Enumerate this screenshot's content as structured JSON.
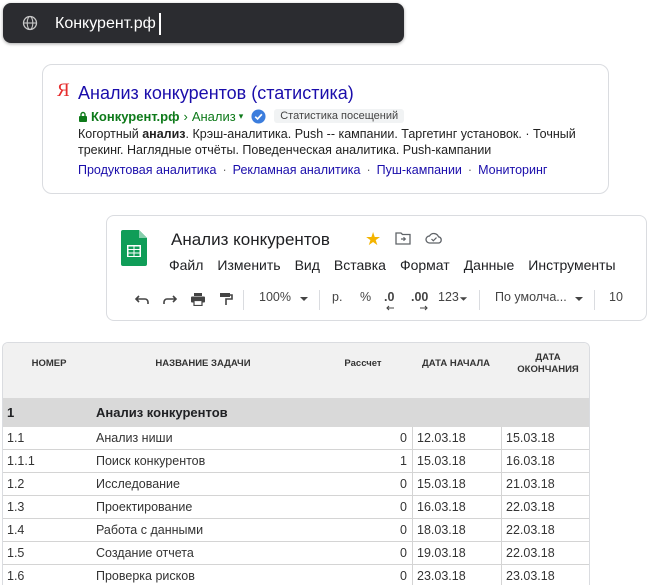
{
  "address_bar": {
    "url": "Конкурент.рф"
  },
  "search_result": {
    "favicon": "Я",
    "title": "Анализ конкурентов (статистика)",
    "domain": "Конкурент.рф",
    "breadcrumb_sep": "›",
    "path": "Анализ",
    "path_arrow": "▾",
    "badge": "Статистика посещений",
    "snippet_part1": "Когортный ",
    "snippet_bold": "анализ",
    "snippet_part2": ". Крэш-аналитика. Push -- кампании. Таргетинг установок. · Точный трекинг. Наглядные отчёты. Поведенческая аналитика. Push-кампании",
    "sitelinks": [
      "Продуктовая аналитика",
      "Рекламная аналитика",
      "Пуш-кампании",
      "Мониторинг"
    ],
    "sitelink_sep": "·",
    "colors": {
      "title": "#1a0dab",
      "url": "#0e7a1a",
      "favicon": "#e62e2e"
    }
  },
  "sheets": {
    "doc_title": "Анализ конкурентов",
    "star": "★",
    "menu": [
      "Файл",
      "Изменить",
      "Вид",
      "Вставка",
      "Формат",
      "Данные",
      "Инструменты"
    ],
    "toolbar": {
      "zoom": "100%",
      "currency": "р.",
      "percent": "%",
      "dec_decrease": ".0",
      "dec_increase": ".00",
      "more_formats": "123",
      "font": "По умолча...",
      "font_size": "10"
    },
    "colors": {
      "logo": "#0f9d58",
      "star": "#f4b400"
    }
  },
  "table": {
    "headers": {
      "number": "НОМЕР",
      "task": "НАЗВАНИЕ ЗАДАЧИ",
      "calc": "Рассчет",
      "start": "ДАТА НАЧАЛА",
      "end_line1": "ДАТА",
      "end_line2": "ОКОНЧАНИЯ"
    },
    "group": {
      "number": "1",
      "name": "Анализ конкурентов"
    },
    "rows": [
      {
        "number": "1.1",
        "name": "Анализ ниши",
        "calc": "0",
        "start": "12.03.18",
        "end": "15.03.18"
      },
      {
        "number": "1.1.1",
        "name": "Поиск конкурентов",
        "calc": "1",
        "start": "15.03.18",
        "end": "16.03.18"
      },
      {
        "number": "1.2",
        "name": "Исследование",
        "calc": "0",
        "start": "15.03.18",
        "end": "21.03.18"
      },
      {
        "number": "1.3",
        "name": "Проектирование",
        "calc": "0",
        "start": "16.03.18",
        "end": "22.03.18"
      },
      {
        "number": "1.4",
        "name": "Работа с данными",
        "calc": "0",
        "start": "18.03.18",
        "end": "22.03.18"
      },
      {
        "number": "1.5",
        "name": "Создание отчета",
        "calc": "0",
        "start": "19.03.18",
        "end": "22.03.18"
      },
      {
        "number": "1.6",
        "name": "Проверка рисков",
        "calc": "0",
        "start": "23.03.18",
        "end": "23.03.18"
      }
    ]
  }
}
